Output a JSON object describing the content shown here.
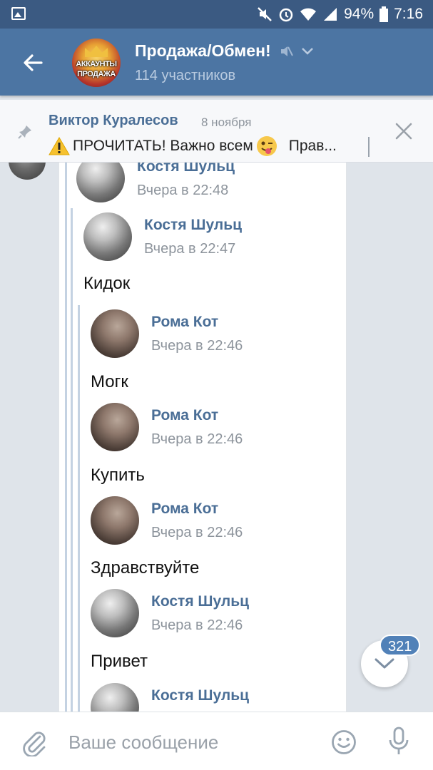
{
  "status_bar": {
    "battery": "94%",
    "time": "7:16",
    "icons": [
      "image-icon",
      "mute-icon",
      "alarm-icon",
      "wifi-icon",
      "signal-icon",
      "battery-icon"
    ]
  },
  "header": {
    "title": "Продажа/Обмен!",
    "subtitle": "114 участников",
    "avatar_text_line1": "АККАУНТЫ",
    "avatar_text_line2": "ПРОДАЖА"
  },
  "pinned": {
    "author": "Виктор Куралесов",
    "date": "8 ноября",
    "text": "ПРОЧИТАТЬ! Важно всем",
    "text_tail": "Прав..."
  },
  "messages": [
    {
      "name": "Костя Шульц",
      "time": "Вчера в 22:48",
      "text": ""
    },
    {
      "name": "Костя Шульц",
      "time": "Вчера в 22:47",
      "text": "Кидок"
    },
    {
      "name": "Рома Кот",
      "time": "Вчера в 22:46",
      "text": "Могк"
    },
    {
      "name": "Рома Кот",
      "time": "Вчера в 22:46",
      "text": "Купить"
    },
    {
      "name": "Рома Кот",
      "time": "Вчера в 22:46",
      "text": "Здравствуйте"
    },
    {
      "name": "Костя Шульц",
      "time": "Вчера в 22:46",
      "text": "Привет"
    },
    {
      "name": "Костя Шульц",
      "time": "",
      "text": ""
    }
  ],
  "scroll_badge": "321",
  "composer": {
    "placeholder": "Ваше сообщение"
  },
  "colors": {
    "status_bar": "#3b5a82",
    "header": "#4c75a3",
    "link_name": "#4a6e96",
    "badge": "#5181b8"
  }
}
